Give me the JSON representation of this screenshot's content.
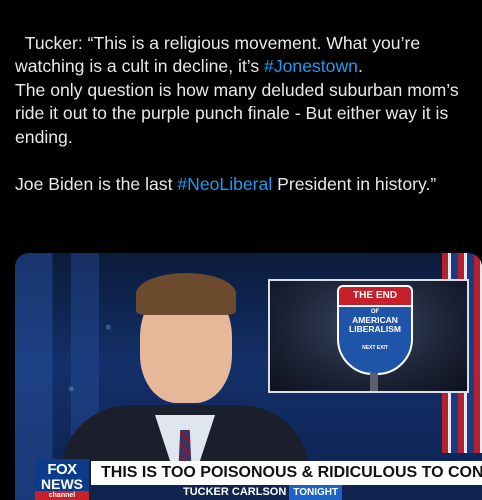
{
  "tweet": {
    "segments": [
      {
        "text": "Tucker: “This is a religious movement. What you’re watching is a cult in decline, it’s ",
        "hashtag": false
      },
      {
        "text": "#Jonestown",
        "hashtag": true
      },
      {
        "text": ".\nThe only question is how many deluded suburban mom’s ride it out to the purple punch finale - But either way it is ending.\n\nJoe Biden is the last ",
        "hashtag": false
      },
      {
        "text": "#NeoLiberal",
        "hashtag": true
      },
      {
        "text": " President in history.”",
        "hashtag": false
      }
    ]
  },
  "media": {
    "inset_sign": {
      "top": "THE END",
      "of": "OF",
      "main": "AMERICAN LIBERALISM",
      "exit": "NEXT EXIT"
    },
    "logo": {
      "fox": "FOX",
      "news": "NEWS",
      "channel": "channel"
    },
    "headline": "THIS IS TOO POISONOUS & RIDICULOUS TO CONTINUE",
    "show_name": "TUCKER CARLSON",
    "show_tag": "TONIGHT"
  },
  "colors": {
    "background": "#000000",
    "text": "#e7e9ea",
    "hashtag": "#1d9bf0",
    "fox_blue": "#0a3c8a",
    "fox_red": "#c8202b"
  }
}
